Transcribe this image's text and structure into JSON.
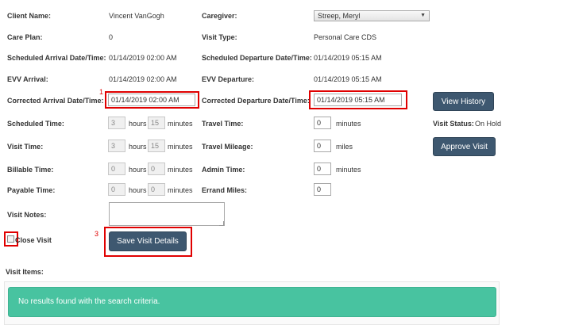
{
  "client": {
    "label": "Client Name:",
    "value": "Vincent VanGogh"
  },
  "caregiver": {
    "label": "Caregiver:",
    "value": "Streep, Meryl"
  },
  "care_plan": {
    "label": "Care Plan:",
    "value": "0"
  },
  "visit_type": {
    "label": "Visit Type:",
    "value": "Personal Care CDS"
  },
  "scheduled_arrival": {
    "label": "Scheduled Arrival Date/Time:",
    "value": "01/14/2019 02:00 AM"
  },
  "scheduled_departure": {
    "label": "Scheduled Departure Date/Time:",
    "value": "01/14/2019 05:15 AM"
  },
  "evv_arrival": {
    "label": "EVV Arrival:",
    "value": "01/14/2019 02:00 AM"
  },
  "evv_departure": {
    "label": "EVV Departure:",
    "value": "01/14/2019 05:15 AM"
  },
  "corrected_arrival": {
    "label": "Corrected Arrival Date/Time:",
    "value": "01/14/2019 02:00 AM"
  },
  "corrected_departure": {
    "label": "Corrected Departure Date/Time:",
    "value": "01/14/2019 05:15 AM"
  },
  "buttons": {
    "view_history": "View History",
    "approve_visit": "Approve Visit",
    "save_visit_details": "Save Visit Details"
  },
  "scheduled_time": {
    "label": "Scheduled Time:",
    "hours": "3",
    "minutes": "15"
  },
  "visit_time": {
    "label": "Visit Time:",
    "hours": "3",
    "minutes": "15"
  },
  "billable_time": {
    "label": "Billable Time:",
    "hours": "0",
    "minutes": "0"
  },
  "payable_time": {
    "label": "Payable Time:",
    "hours": "0",
    "minutes": "0"
  },
  "units": {
    "hours": "hours",
    "minutes": "minutes",
    "miles": "miles"
  },
  "travel_time": {
    "label": "Travel Time:",
    "value": "0"
  },
  "travel_mileage": {
    "label": "Travel Mileage:",
    "value": "0"
  },
  "admin_time": {
    "label": "Admin Time:",
    "value": "0"
  },
  "errand_miles": {
    "label": "Errand Miles:",
    "value": "0"
  },
  "visit_status": {
    "label": "Visit Status:",
    "value": "On Hold"
  },
  "visit_notes": {
    "label": "Visit Notes:",
    "value": ""
  },
  "close_visit": {
    "label": "Close Visit"
  },
  "visit_items": {
    "label": "Visit Items:",
    "empty_message": "No results found with the search criteria."
  },
  "annotations": {
    "marker1": "1",
    "marker3": "3"
  },
  "colors": {
    "button": "#3e5870",
    "results": "#48c3a0",
    "highlight": "#e00000"
  }
}
